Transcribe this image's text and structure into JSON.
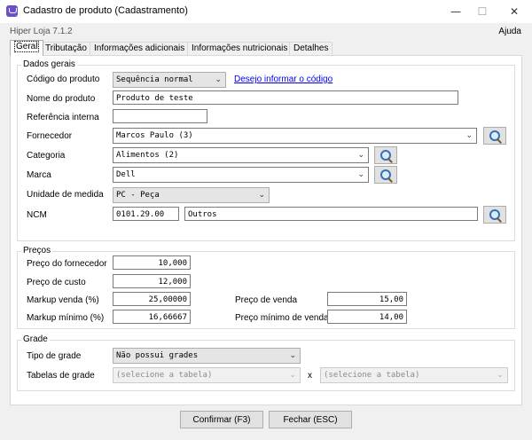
{
  "window": {
    "title": "Cadastro de produto (Cadastramento)",
    "minimize": "—",
    "maximize": "☐",
    "close": "✕"
  },
  "app": {
    "subtitle": "Hiper Loja 7.1.2",
    "help": "Ajuda"
  },
  "tabs": [
    "Geral",
    "Tributação",
    "Informações adicionais",
    "Informações nutricionais",
    "Detalhes"
  ],
  "dados_gerais": {
    "legend": "Dados gerais",
    "codigo_label": "Código do produto",
    "codigo_value": "Sequência normal",
    "codigo_link": "Desejo informar o código",
    "nome_label": "Nome do produto",
    "nome_value": "Produto de teste",
    "referencia_label": "Referência interna",
    "referencia_value": "",
    "fornecedor_label": "Fornecedor",
    "fornecedor_value": "Marcos Paulo (3)",
    "categoria_label": "Categoria",
    "categoria_value": "Alimentos (2)",
    "marca_label": "Marca",
    "marca_value": "Dell",
    "unidade_label": "Unidade de medida",
    "unidade_value": "PC - Peça",
    "ncm_label": "NCM",
    "ncm_code": "0101.29.00",
    "ncm_desc": "Outros"
  },
  "precos": {
    "legend": "Preços",
    "fornecedor_label": "Preço do fornecedor",
    "fornecedor_value": "10,000",
    "custo_label": "Preço de custo",
    "custo_value": "12,000",
    "markup_venda_label": "Markup venda  (%)",
    "markup_venda_value": "25,00000",
    "markup_minimo_label": "Markup mínimo  (%)",
    "markup_minimo_value": "16,66667",
    "venda_label": "Preço de venda",
    "venda_value": "15,00",
    "minimo_label": "Preço mínimo de venda",
    "minimo_value": "14,00"
  },
  "grade": {
    "legend": "Grade",
    "tipo_label": "Tipo de grade",
    "tipo_value": "Não possui grades",
    "tabelas_label": "Tabelas de grade",
    "tabela1_value": "(selecione a tabela)",
    "separator": "x",
    "tabela2_value": "(selecione a tabela)"
  },
  "buttons": {
    "confirmar": "Confirmar (F3)",
    "fechar": "Fechar (ESC)"
  },
  "icons": {
    "search": "search-icon",
    "chevron": "chevron-down-icon",
    "accent": "#6a4fc8",
    "link_color": "#0000ee"
  }
}
